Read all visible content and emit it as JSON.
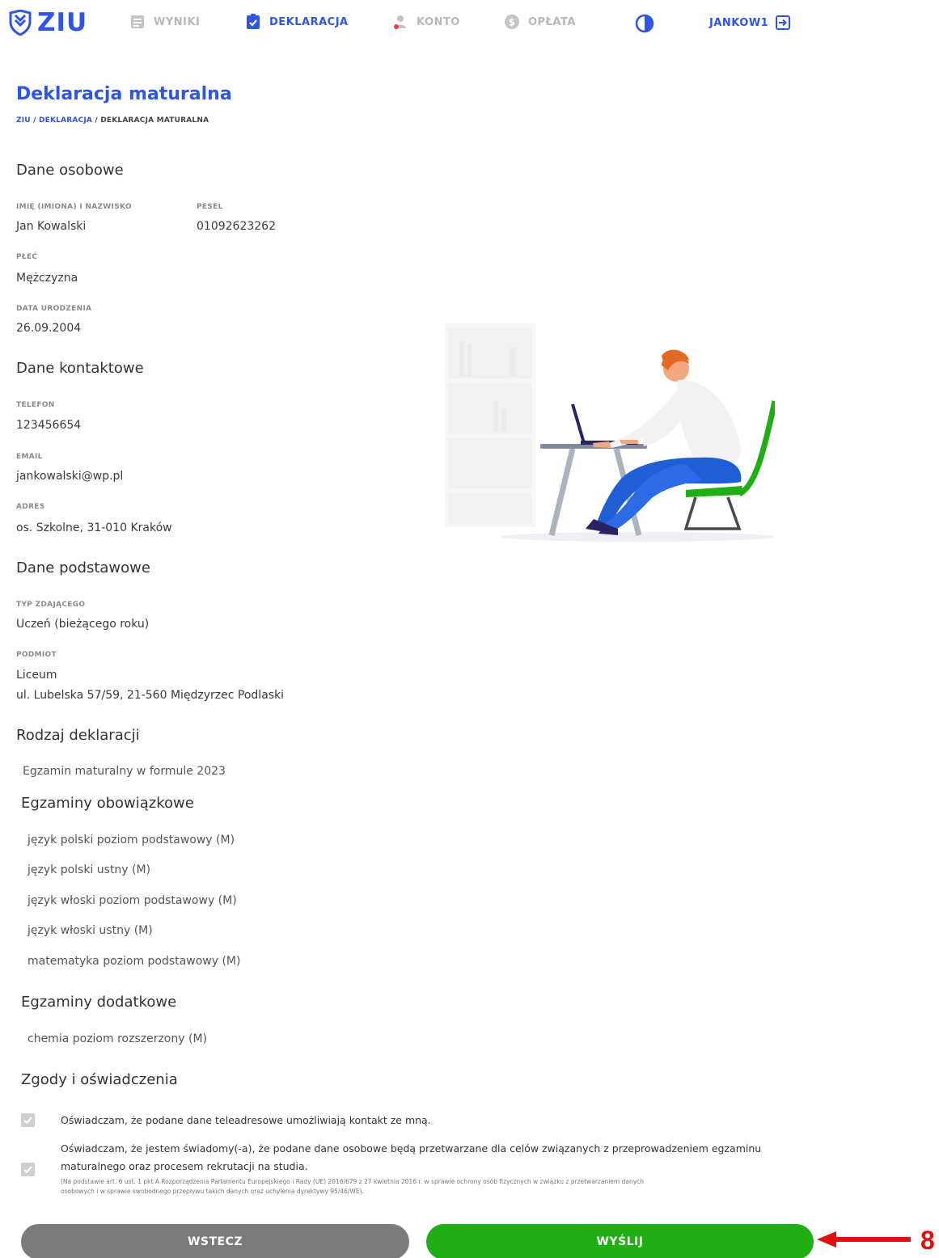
{
  "nav": {
    "logo": "ZIU",
    "items": [
      {
        "label": "WYNIKI",
        "icon": "list-icon"
      },
      {
        "label": "DEKLARACJA",
        "icon": "checklist-icon"
      },
      {
        "label": "KONTO",
        "icon": "user-icon"
      },
      {
        "label": "OPŁATA",
        "icon": "coin-icon"
      }
    ],
    "contrast_icon": "contrast-icon",
    "user": "JANKOW1",
    "logout_icon": "logout-icon"
  },
  "header": {
    "title": "Deklaracja maturalna",
    "breadcrumb": {
      "home": "ZIU",
      "sep1": " / ",
      "parent": "DEKLARACJA",
      "sep2": " / ",
      "current": "DEKLARACJA MATURALNA"
    }
  },
  "personal": {
    "heading": "Dane osobowe",
    "name_label": "IMIĘ (IMIONA) I NAZWISKO",
    "name": "Jan Kowalski",
    "pesel_label": "PESEL",
    "pesel": "01092623262",
    "sex_label": "PŁEĆ",
    "sex": "Mężczyzna",
    "dob_label": "DATA URODZENIA",
    "dob": "26.09.2004"
  },
  "contact": {
    "heading": "Dane kontaktowe",
    "phone_label": "TELEFON",
    "phone": "123456654",
    "email_label": "EMAIL",
    "email": "jankowalski@wp.pl",
    "address_label": "ADRES",
    "address": "os. Szkolne, 31-010 Kraków"
  },
  "basic": {
    "heading": "Dane podstawowe",
    "type_label": "TYP ZDAJĄCEGO",
    "type": "Uczeń (bieżącego roku)",
    "entity_label": "PODMIOT",
    "entity_name": "Liceum",
    "entity_address": "ul. Lubelska 57/59, 21-560 Międzyrzec Podlaski"
  },
  "declaration": {
    "heading": "Rodzaj deklaracji",
    "type": "Egzamin maturalny w formule 2023"
  },
  "mandatory": {
    "heading": "Egzaminy obowiązkowe",
    "items": [
      "język polski poziom podstawowy (M)",
      "język polski ustny (M)",
      "język włoski poziom podstawowy (M)",
      "język włoski ustny (M)",
      "matematyka poziom podstawowy (M)"
    ]
  },
  "additional": {
    "heading": "Egzaminy dodatkowe",
    "items": [
      "chemia poziom rozszerzony (M)"
    ]
  },
  "consents": {
    "heading": "Zgody i oświadczenia",
    "c1": "Oświadczam, że podane dane teleadresowe umożliwiają kontakt ze mną.",
    "c2_line1": "Oświadczam, że jestem świadomy(-a), że podane dane osobowe będą przetwarzane dla celów związanych z przeprowadzeniem egzaminu",
    "c2_line2": "maturalnego oraz procesem rekrutacji na studia.",
    "c2_note_line1": "(Na podstawie art. 6 ust. 1 pkt A Rozporządzenia Parlamentu Europejskiego i Rady (UE) 2016/679 z 27 kwietnia 2016 r. w sprawie ochrony osób fizycznych w związku z przetwarzaniem danych",
    "c2_note_line2": "osobowych i w sprawie swobodnego przepływu takich danych oraz uchylenia dyrektywy 95/46/WE).",
    "c1_checked": true,
    "c2_checked": true
  },
  "buttons": {
    "back": "WSTECZ",
    "send": "WYŚLIJ"
  },
  "annotation": {
    "number": "8",
    "color": "#e01010"
  },
  "colors": {
    "accent": "#2f55e4",
    "send": "#1fae14",
    "back": "#7b7b7b"
  }
}
